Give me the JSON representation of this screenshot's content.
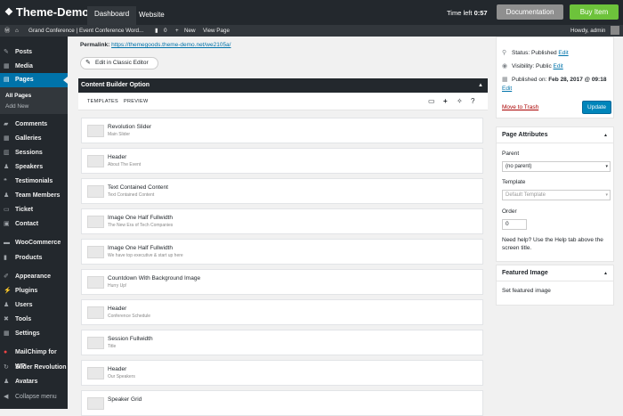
{
  "topbar": {
    "brand": "Theme-Demo",
    "brand_icon": "grid-icon",
    "nav": [
      "Dashboard",
      "Website"
    ],
    "time_left_label": "Time left",
    "time_left_value": "0:57",
    "documentation": "Documentation",
    "buy_item": "Buy Item"
  },
  "adminbar": {
    "site": "Grand Conference | Event Conference Word...",
    "comments_count": "0",
    "new": "New",
    "view_page": "View Page",
    "howdy": "Howdy, admin"
  },
  "sidebar": {
    "items": [
      "Posts",
      "Media",
      "Pages",
      "Comments",
      "Galleries",
      "Sessions",
      "Speakers",
      "Testimonials",
      "Team Members",
      "Ticket",
      "Contact",
      "WooCommerce",
      "Products",
      "Appearance",
      "Plugins",
      "Users",
      "Tools",
      "Settings",
      "MailChimp for WP",
      "Slider Revolution",
      "Avatars",
      "Collapse menu"
    ],
    "sub_items": [
      "All Pages",
      "Add New"
    ]
  },
  "main": {
    "permalink_label": "Permalink:",
    "permalink_url": "https://themegoods.theme-demo.net/we2105a/",
    "classic_editor": "Edit in Classic Editor",
    "builder_title": "Content Builder Option",
    "tabs": [
      "TEMPLATES",
      "PREVIEW"
    ],
    "blocks": [
      {
        "title": "Revolution Slider",
        "sub": "Main Slider"
      },
      {
        "title": "Header",
        "sub": "About The Event"
      },
      {
        "title": "Text Contained Content",
        "sub": "Text Contained Content"
      },
      {
        "title": "Image One Half Fullwidth",
        "sub": "The New Era of Tech Companies"
      },
      {
        "title": "Image One Half Fullwidth",
        "sub": "We have top executive & start up here"
      },
      {
        "title": "Countdown With Background Image",
        "sub": "Hurry Up!"
      },
      {
        "title": "Header",
        "sub": "Conference Schedule"
      },
      {
        "title": "Session Fullwidth",
        "sub": "Title"
      },
      {
        "title": "Header",
        "sub": "Our Speakers"
      },
      {
        "title": "Speaker Grid",
        "sub": ""
      }
    ]
  },
  "publish": {
    "status_label": "Status:",
    "status_value": "Published",
    "visibility_label": "Visibility:",
    "visibility_value": "Public",
    "published_label": "Published on:",
    "published_value": "Feb 28, 2017 @ 09:18",
    "edit": "Edit",
    "trash": "Move to Trash",
    "update": "Update"
  },
  "page_attributes": {
    "title": "Page Attributes",
    "parent_label": "Parent",
    "parent_value": "(no parent)",
    "template_label": "Template",
    "template_value": "Default Template",
    "order_label": "Order",
    "order_value": "0",
    "help": "Need help? Use the Help tab above the screen title."
  },
  "featured_image": {
    "title": "Featured Image",
    "link": "Set featured image"
  }
}
